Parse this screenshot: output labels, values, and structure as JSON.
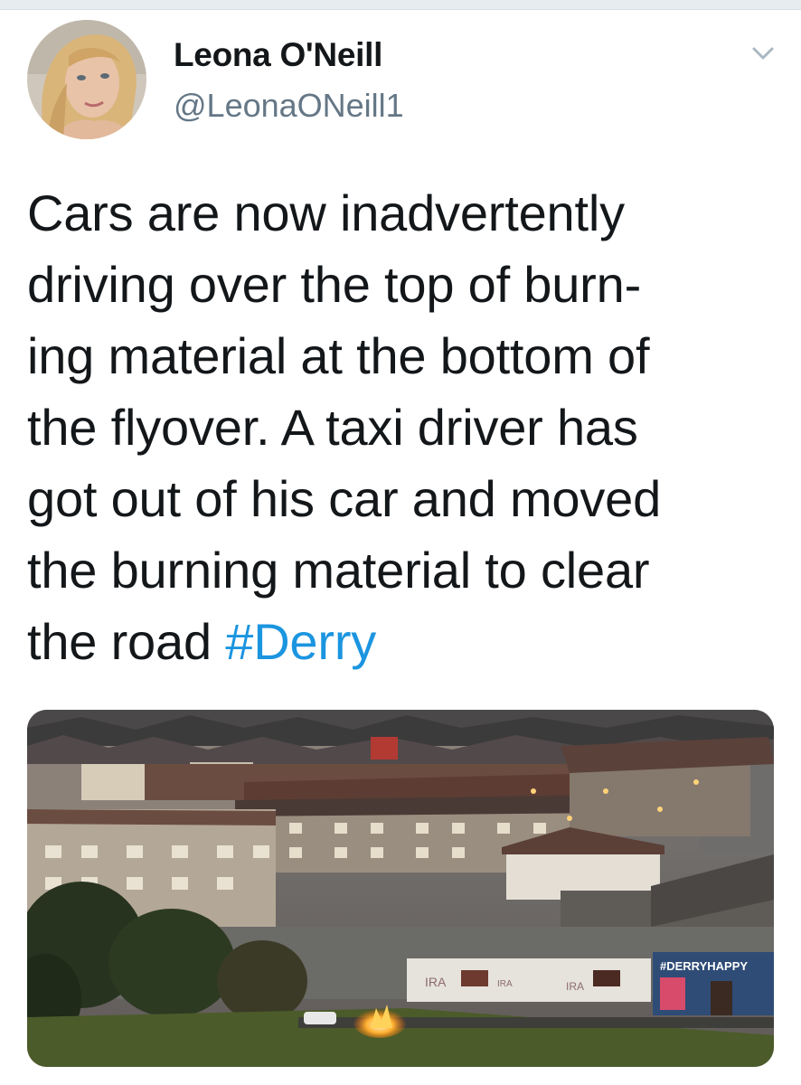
{
  "tweet": {
    "author_name": "Leona O'Neill",
    "author_handle": "@LeonaONeill1",
    "text_lines": [
      "Cars are now inadvertently",
      "driving over the top of burn-",
      "ing material at the bottom of",
      "the flyover. A taxi driver has",
      "got out of his car and moved",
      "the burning material to clear"
    ],
    "text_last_prefix": "the road ",
    "hashtag": "#Derry",
    "menu_icon": "chevron-down-icon",
    "media": {
      "mural_text": "#DERRYHAPPY",
      "graffiti": [
        "IRA",
        "IRA",
        "IRA"
      ]
    }
  },
  "colors": {
    "text": "#14171a",
    "secondary": "#657786",
    "link": "#1b95e0"
  }
}
